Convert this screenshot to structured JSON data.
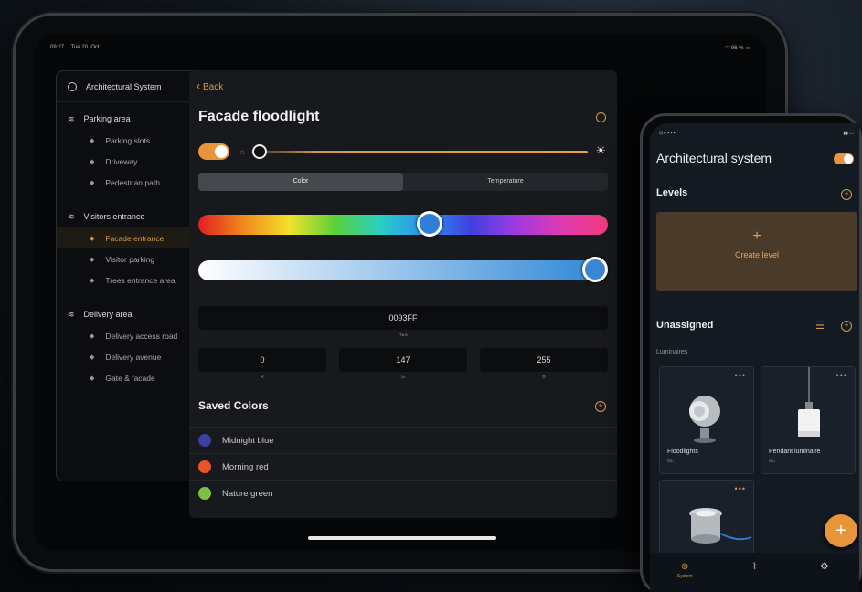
{
  "tablet": {
    "status": {
      "time": "09:27",
      "date": "Tue 20. Oct",
      "battery": "96 %"
    },
    "nav": {
      "title": "Architectural System",
      "groups": [
        {
          "label": "Parking area",
          "items": [
            "Parking slots",
            "Driveway",
            "Pedestrian path"
          ]
        },
        {
          "label": "Visitors entrance",
          "items": [
            "Facade entrance",
            "Visitor parking",
            "Trees entrance area"
          ]
        },
        {
          "label": "Delivery area",
          "items": [
            "Delivery access road",
            "Delivery avenue",
            "Gate & facade"
          ]
        }
      ],
      "active_item": "Facade entrance"
    },
    "detail": {
      "back_label": "Back",
      "title": "Facade floodlight",
      "tabs": [
        "Color",
        "Temperature"
      ],
      "active_tab": "Color",
      "power_on": true,
      "brightness": 0.0,
      "hue_position": 0.57,
      "saturation_position": 1.0,
      "hex_value": "0093FF",
      "hex_label": "HEX",
      "rgb": [
        {
          "value": "0",
          "label": "R"
        },
        {
          "value": "147",
          "label": "G"
        },
        {
          "value": "255",
          "label": "B"
        }
      ],
      "saved_title": "Saved Colors",
      "saved_colors": [
        {
          "name": "Midnight blue",
          "color": "#3a3fa0"
        },
        {
          "name": "Morning red",
          "color": "#e8542a"
        },
        {
          "name": "Nature green",
          "color": "#7cc242"
        }
      ]
    }
  },
  "phone": {
    "title": "Architectural system",
    "levels_label": "Levels",
    "create_level_label": "Create level",
    "unassigned_label": "Unassigned",
    "luminaires_label": "Luminaires",
    "cards": [
      {
        "name": "Floodlights",
        "status": "On"
      },
      {
        "name": "Pendant luminaire",
        "status": "On"
      },
      {
        "name": "",
        "status": ""
      }
    ],
    "bottom_nav": [
      {
        "label": "System",
        "icon": "system-icon",
        "active": true
      },
      {
        "label": "",
        "icon": "scenes-icon",
        "active": false
      },
      {
        "label": "",
        "icon": "settings-icon",
        "active": false
      }
    ]
  },
  "colors": {
    "accent": "#d79a45",
    "toggle": "#e8943a",
    "panel": "#17191c"
  }
}
